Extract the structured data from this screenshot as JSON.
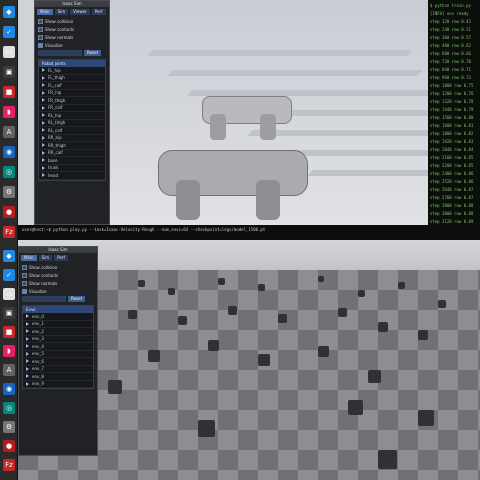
{
  "dock": {
    "icons": [
      {
        "name": "vscode-icon",
        "color": "#1e88e5",
        "glyph": "◆"
      },
      {
        "name": "check-app-icon",
        "color": "#1e88e5",
        "glyph": "✓"
      },
      {
        "name": "file-icon",
        "color": "#e0e0e0",
        "glyph": "▭"
      },
      {
        "name": "terminal-icon",
        "color": "#3a3a3a",
        "glyph": "▣"
      },
      {
        "name": "red-app-icon",
        "color": "#c62828",
        "glyph": "■"
      },
      {
        "name": "pink-app-icon",
        "color": "#e91e63",
        "glyph": "◗"
      },
      {
        "name": "a-app-icon",
        "color": "#616161",
        "glyph": "A"
      },
      {
        "name": "blue-app-icon",
        "color": "#1565c0",
        "glyph": "◉"
      },
      {
        "name": "teal-app-icon",
        "color": "#00897b",
        "glyph": "◎"
      },
      {
        "name": "settings-icon",
        "color": "#757575",
        "glyph": "⚙"
      },
      {
        "name": "red-app-2-icon",
        "color": "#b71c1c",
        "glyph": "●"
      },
      {
        "name": "filezilla-icon",
        "color": "#c62828",
        "glyph": "Fz"
      }
    ]
  },
  "top_viewer": {
    "panel": {
      "title": "Isaac Sim",
      "tabs": [
        "Main",
        "Sim",
        "Viewer",
        "Perf"
      ],
      "options": [
        {
          "label": "Show collision",
          "checked": false
        },
        {
          "label": "Show contacts",
          "checked": false
        },
        {
          "label": "Show normals",
          "checked": false
        },
        {
          "label": "Visualize",
          "checked": true
        }
      ],
      "button_label": "Reset",
      "list_header": "Robot joints",
      "joints": [
        "FL_hip",
        "FL_thigh",
        "FL_calf",
        "FR_hip",
        "FR_thigh",
        "FR_calf",
        "RL_hip",
        "RL_thigh",
        "RL_calf",
        "RR_hip",
        "RR_thigh",
        "RR_calf",
        "base",
        "trunk",
        "head"
      ]
    },
    "terminal_lines": [
      "$ python train.py",
      "[INFO] env ready",
      "step 120 rew 0.43",
      "step 240 rew 0.51",
      "step 360 rew 0.57",
      "step 480 rew 0.62",
      "step 600 rew 0.66",
      "step 720 rew 0.70",
      "step 840 rew 0.71",
      "step 960 rew 0.73",
      "step 1080 rew 0.75",
      "step 1200 rew 0.76",
      "step 1320 rew 0.78",
      "step 1440 rew 0.79",
      "step 1560 rew 0.80",
      "step 1680 rew 0.81",
      "step 1800 rew 0.82",
      "step 1920 rew 0.83",
      "step 2040 rew 0.84",
      "step 2160 rew 0.85",
      "step 2280 rew 0.85",
      "step 2400 rew 0.86",
      "step 2520 rew 0.86",
      "step 2640 rew 0.87",
      "step 2760 rew 0.87",
      "step 2880 rew 0.88",
      "step 3000 rew 0.88",
      "step 3120 rew 0.89"
    ],
    "cmdline": "user@host:~$ python play.py --task=Isaac-Velocity-Rough --num_envs=64 --checkpoint=logs/model_1500.pt"
  },
  "bottom_viewer": {
    "panel": {
      "title": "Isaac Sim",
      "tabs": [
        "Main",
        "Sim",
        "Perf"
      ],
      "options": [
        {
          "label": "Show collision",
          "checked": false
        },
        {
          "label": "Show contacts",
          "checked": false
        },
        {
          "label": "Show normals",
          "checked": false
        },
        {
          "label": "Visualize",
          "checked": true
        }
      ],
      "button_label": "Reset",
      "list_header": "Envs",
      "envs": [
        "env_0",
        "env_1",
        "env_2",
        "env_3",
        "env_4",
        "env_5",
        "env_6",
        "env_7",
        "env_8",
        "env_9"
      ]
    }
  }
}
